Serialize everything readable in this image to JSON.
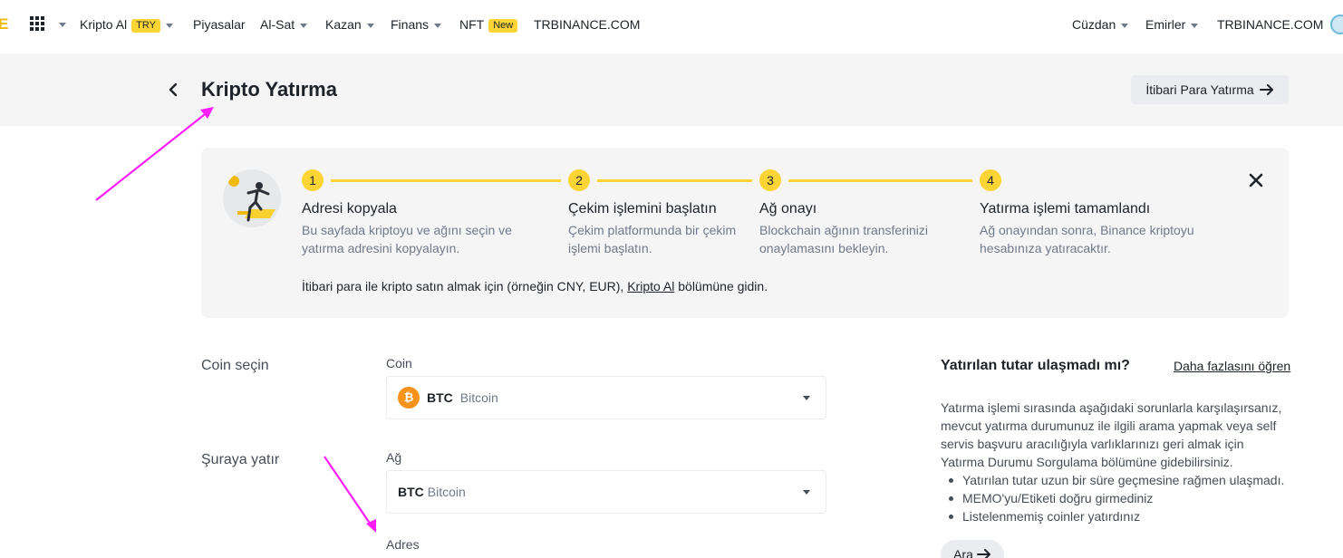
{
  "nav": {
    "logo_letter": "E",
    "buy_crypto": "Kripto Al",
    "buy_crypto_badge": "TRY",
    "markets": "Piyasalar",
    "trade": "Al-Sat",
    "earn": "Kazan",
    "finance": "Finans",
    "nft": "NFT",
    "nft_badge": "New",
    "site_left": "TRBINANCE.COM",
    "wallet": "Cüzdan",
    "orders": "Emirler",
    "site_right": "TRBINANCE.COM"
  },
  "header": {
    "title": "Kripto Yatırma",
    "fiat_button": "İtibari Para Yatırma"
  },
  "steps": [
    {
      "num": "1",
      "title": "Adresi kopyala",
      "desc_1": "Bu sayfada kriptoyu ve ağını seçin ve",
      "desc_2": "yatırma adresini kopyalayın."
    },
    {
      "num": "2",
      "title": "Çekim işlemini başlatın",
      "desc_1": "Çekim platformunda bir çekim",
      "desc_2": "işlemi başlatın."
    },
    {
      "num": "3",
      "title": "Ağ onayı",
      "desc_1": "Blockchain ağının transferinizi",
      "desc_2": "onaylamasını bekleyin."
    },
    {
      "num": "4",
      "title": "Yatırma işlemi tamamlandı",
      "desc_1": "Ağ onayından sonra, Binance kriptoyu",
      "desc_2": "hesabınıza yatıracaktır."
    }
  ],
  "fiat_note": {
    "before": "İtibari para ile kripto satın almak için (örneğin CNY, EUR), ",
    "link": "Kripto Al",
    "after": " bölümüne gidin."
  },
  "form": {
    "coin_section_label": "Coin seçin",
    "coin_field_label": "Coin",
    "coin_symbol": "BTC",
    "coin_name": "Bitcoin",
    "coin_icon_glyph": "₿",
    "deposit_section_label": "Şuraya yatır",
    "network_field_label": "Ağ",
    "network_symbol": "BTC",
    "network_name": "Bitcoin",
    "address_label": "Adres"
  },
  "help": {
    "title": "Yatırılan tutar ulaşmadı mı?",
    "learn_more": "Daha fazlasını öğren",
    "line_1": "Yatırma işlemi sırasında aşağıdaki sorunlarla karşılaşırsanız,",
    "line_2": "mevcut yatırma durumunuz ile ilgili arama yapmak veya self",
    "line_3": "servis başvuru aracılığıyla varlıklarınızı geri almak için",
    "line_4": "Yatırma Durumu Sorgulama bölümüne gidebilirsiniz.",
    "bullets": [
      "Yatırılan tutar uzun bir süre geçmesine rağmen ulaşmadı.",
      "MEMO'yu/Etiketi doğru girmediniz",
      "Listelenmemiş coinler yatırdınız"
    ],
    "search_button": "Ara"
  },
  "colors": {
    "accent": "#fcd535",
    "annotation_arrow": "#ff1dfc"
  }
}
